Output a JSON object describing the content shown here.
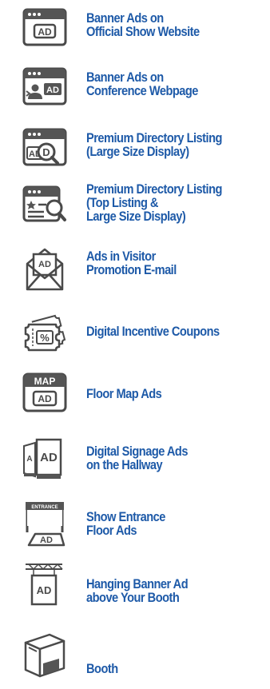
{
  "items": [
    {
      "icon": "browser-ad-icon",
      "lines": [
        "Banner Ads on",
        "Official Show Website"
      ]
    },
    {
      "icon": "browser-person-ad-icon",
      "lines": [
        "Banner Ads on",
        "Conference Webpage"
      ]
    },
    {
      "icon": "browser-magnifier-ad-icon",
      "lines": [
        "Premium Directory Listing",
        "(Large Size Display)"
      ]
    },
    {
      "icon": "browser-star-list-search-icon",
      "lines": [
        "Premium Directory Listing",
        "(Top Listing &",
        "Large Size Display)"
      ]
    },
    {
      "icon": "envelope-ad-icon",
      "lines": [
        "Ads in Visitor",
        "Promotion E-mail"
      ]
    },
    {
      "icon": "coupon-percent-icon",
      "lines": [
        "Digital Incentive Coupons"
      ]
    },
    {
      "icon": "map-ad-icon",
      "lines": [
        "Floor Map Ads"
      ]
    },
    {
      "icon": "signage-ad-icon",
      "lines": [
        "Digital Signage Ads",
        "on the Hallway"
      ]
    },
    {
      "icon": "entrance-floor-ad-icon",
      "icon_text": "ENTRANCE",
      "lines": [
        "Show Entrance",
        "Floor Ads"
      ]
    },
    {
      "icon": "hanging-banner-ad-icon",
      "lines": [
        "Hanging Banner Ad",
        "above Your Booth"
      ]
    },
    {
      "icon": "booth-icon",
      "lines": [
        "Booth"
      ]
    }
  ],
  "colors": {
    "text": "#1e5aa8",
    "icon_stroke": "#4a4a4a",
    "icon_fill": "#555555",
    "icon_bg": "#ffffff"
  },
  "icon_labels": {
    "ad": "AD",
    "map": "MAP",
    "percent": "%"
  }
}
